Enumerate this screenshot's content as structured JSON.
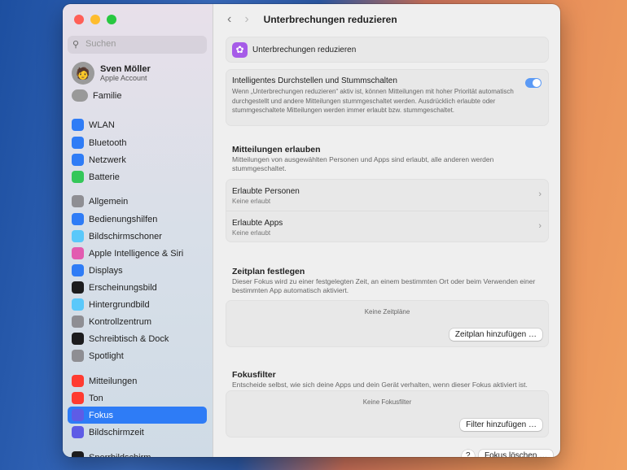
{
  "sidebar": {
    "search_placeholder": "Suchen",
    "profile": {
      "name": "Sven Möller",
      "subtitle": "Apple Account"
    },
    "family": "Familie",
    "items": [
      {
        "label": "WLAN",
        "icon": "wifi-icon",
        "color": "#2f7cf6"
      },
      {
        "label": "Bluetooth",
        "icon": "bluetooth-icon",
        "color": "#2f7cf6"
      },
      {
        "label": "Netzwerk",
        "icon": "globe-icon",
        "color": "#2f7cf6"
      },
      {
        "label": "Batterie",
        "icon": "battery-icon",
        "color": "#34c759"
      },
      {
        "label": "Allgemein",
        "icon": "gear-icon",
        "color": "#8e8e93"
      },
      {
        "label": "Bedienungshilfen",
        "icon": "accessibility-icon",
        "color": "#2f7cf6"
      },
      {
        "label": "Bildschirmschoner",
        "icon": "screensaver-icon",
        "color": "#5ac8fa"
      },
      {
        "label": "Apple Intelligence & Siri",
        "icon": "siri-icon",
        "color": "#e25bb0"
      },
      {
        "label": "Displays",
        "icon": "sun-icon",
        "color": "#2f7cf6"
      },
      {
        "label": "Erscheinungsbild",
        "icon": "appearance-icon",
        "color": "#1c1c1e"
      },
      {
        "label": "Hintergrundbild",
        "icon": "wallpaper-icon",
        "color": "#5ac8fa"
      },
      {
        "label": "Kontrollzentrum",
        "icon": "control-center-icon",
        "color": "#8e8e93"
      },
      {
        "label": "Schreibtisch & Dock",
        "icon": "dock-icon",
        "color": "#1c1c1e"
      },
      {
        "label": "Spotlight",
        "icon": "magnifier-icon",
        "color": "#8e8e93"
      },
      {
        "label": "Mitteilungen",
        "icon": "bell-icon",
        "color": "#ff3b30"
      },
      {
        "label": "Ton",
        "icon": "speaker-icon",
        "color": "#ff3b30"
      },
      {
        "label": "Fokus",
        "icon": "moon-icon",
        "color": "#5e5ce6",
        "selected": true
      },
      {
        "label": "Bildschirmzeit",
        "icon": "hourglass-icon",
        "color": "#5e5ce6"
      },
      {
        "label": "Sperrbildschirm",
        "icon": "lock-icon",
        "color": "#1c1c1e"
      }
    ]
  },
  "header": {
    "title": "Unterbrechungen reduzieren"
  },
  "main": {
    "focus_name": "Unterbrechungen reduzieren",
    "intelligent": {
      "title": "Intelligentes Durchstellen und Stummschalten",
      "desc": "Wenn „Unterbrechungen reduzieren“ aktiv ist, können Mitteilungen mit hoher Priorität automatisch durchgestellt und andere Mitteilungen stummgeschaltet werden. Ausdrücklich erlaubte oder stummgeschaltete Mitteilungen werden immer erlaubt bzw. stummgeschaltet.",
      "enabled": true
    },
    "allow": {
      "title": "Mitteilungen erlauben",
      "desc": "Mitteilungen von ausgewählten Personen und Apps sind erlaubt, alle anderen werden stummgeschaltet.",
      "people": {
        "label": "Erlaubte Personen",
        "value": "Keine erlaubt"
      },
      "apps": {
        "label": "Erlaubte Apps",
        "value": "Keine erlaubt"
      }
    },
    "schedule": {
      "title": "Zeitplan festlegen",
      "desc": "Dieser Fokus wird zu einer festgelegten Zeit, an einem bestimmten Ort oder beim Verwenden einer bestimmten App automatisch aktiviert.",
      "empty": "Keine Zeitpläne",
      "add": "Zeitplan hinzufügen …"
    },
    "filter": {
      "title": "Fokusfilter",
      "desc": "Entscheide selbst, wie sich deine Apps und dein Gerät verhalten, wenn dieser Fokus aktiviert ist.",
      "empty": "Keine Fokusfilter",
      "add": "Filter hinzufügen …"
    },
    "help": "?",
    "delete": "Fokus löschen …"
  }
}
